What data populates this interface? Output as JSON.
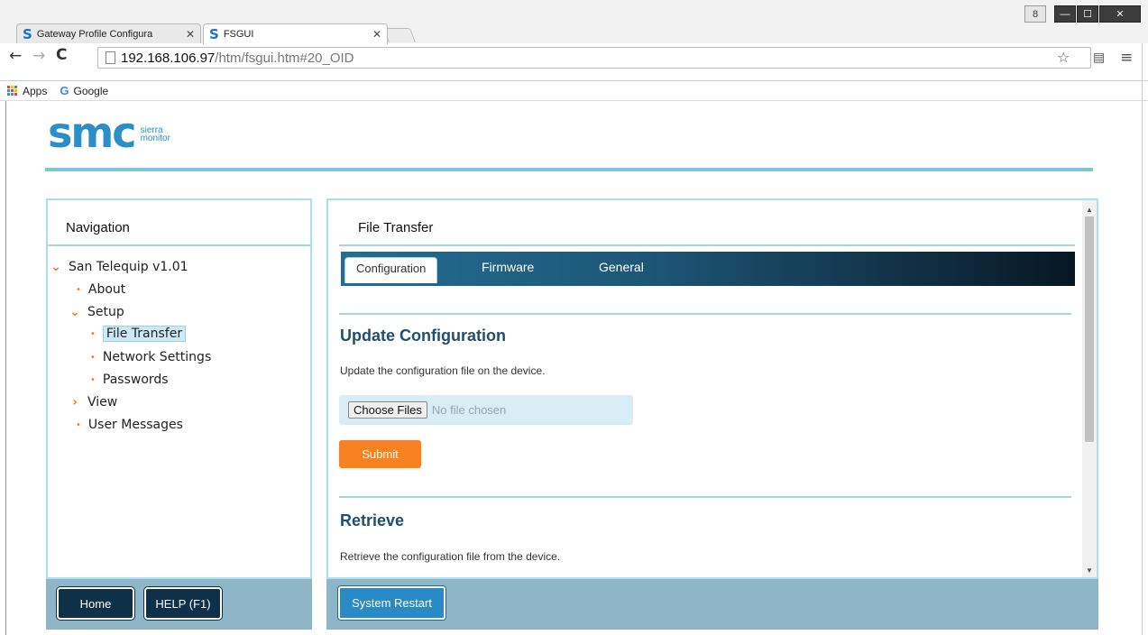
{
  "browser": {
    "tabs": [
      {
        "title": "Gateway Profile Configura",
        "icon": "smc-s-icon"
      },
      {
        "title": "FSGUI",
        "icon": "smc-s-icon"
      }
    ],
    "url_host": "192.168.106.97",
    "url_path": "/htm/fsgui.htm#20_OID",
    "bookmarks": [
      "Apps",
      "Google"
    ],
    "user_button": "8"
  },
  "logo": {
    "mark": "SMC",
    "line1": "sierra",
    "line2": "monitor",
    "color": "#2a8fc9"
  },
  "navigation": {
    "title": "Navigation",
    "items": [
      {
        "label": "San Telequip v1.01",
        "icon": "chevron-down-icon"
      },
      {
        "label": "About",
        "icon": "bullet-icon"
      },
      {
        "label": "Setup",
        "icon": "chevron-down-icon"
      },
      {
        "label": "File Transfer",
        "icon": "bullet-icon",
        "selected": true
      },
      {
        "label": "Network Settings",
        "icon": "bullet-icon"
      },
      {
        "label": "Passwords",
        "icon": "bullet-icon"
      },
      {
        "label": "View",
        "icon": "chevron-right-icon"
      },
      {
        "label": "User Messages",
        "icon": "bullet-icon"
      }
    ]
  },
  "main": {
    "title": "File Transfer",
    "tabs": [
      {
        "label": "Configuration",
        "active": true
      },
      {
        "label": "Firmware"
      },
      {
        "label": "General"
      }
    ],
    "update": {
      "heading": "Update Configuration",
      "description": "Update the configuration file on the device.",
      "choose_label": "Choose Files",
      "file_status": "No file chosen",
      "submit_label": "Submit"
    },
    "retrieve": {
      "heading": "Retrieve",
      "description": "Retrieve the configuration file from the device."
    }
  },
  "footer": {
    "home_label": "Home",
    "help_label": "HELP (F1)",
    "restart_label": "System Restart"
  },
  "colors": {
    "accent_orange": "#f7821f",
    "panel_border": "#a9e0ee",
    "footer_bg": "#8fb6c8",
    "heading_blue": "#1f4e6e"
  }
}
